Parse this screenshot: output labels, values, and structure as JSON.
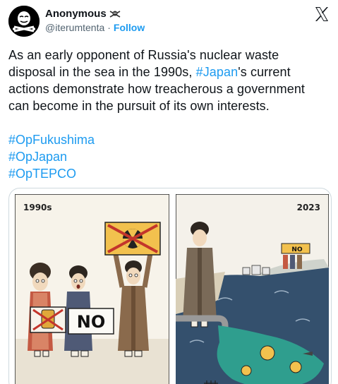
{
  "author": {
    "display_name": "Anonymous",
    "handle": "@iterumtenta",
    "separator": "·",
    "follow_label": "Follow"
  },
  "tweet": {
    "line1": "As an early opponent of Russia's nuclear waste",
    "line2_pre": "disposal in the sea in the 1990s, ",
    "line2_tag": "#Japan",
    "line2_post": "'s current",
    "line3": "actions demonstrate how treacherous a government",
    "line4": "can become in the pursuit of its own interests.",
    "hashtags": [
      "#OpFukushima",
      "#OpJapan",
      "#OpTEPCO"
    ]
  },
  "comic": {
    "left_year": "1990s",
    "right_year": "2023",
    "sign_no": "NO",
    "small_sign_no": "NO"
  },
  "colors": {
    "link": "#1d9bf0",
    "text": "#0f1419",
    "secondary": "#536471",
    "sea": "#34506d",
    "toxic": "#2f9e8e",
    "sign_yellow": "#f2c14e"
  }
}
